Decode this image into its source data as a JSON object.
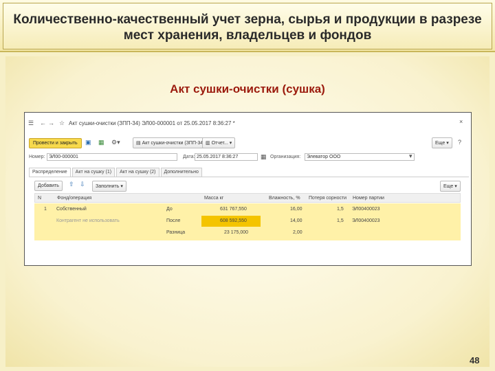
{
  "slide": {
    "title": "Количественно-качественный учет зерна, сырья и продукции в разрезе мест хранения, владельцев и фондов",
    "subtitle": "Акт сушки-очистки (сушка)",
    "page_number": "48"
  },
  "window": {
    "title": "Акт сушки-очистки (ЗПП-34) ЭЛ00-000001 от 25.05.2017 8:36:27 *",
    "toolbar": {
      "post_close": "Провести и закрыть",
      "act_label": "Акт сушки-очистки (ЗПП-34)",
      "report": "Отчет...",
      "more": "Еще"
    },
    "header": {
      "number_label": "Номер:",
      "number_value": "ЭЛ00-000001",
      "date_label": "Дата:",
      "date_value": "25.05.2017  8:36:27",
      "org_label": "Организация:",
      "org_value": "Элеватор ООО"
    },
    "tabs": [
      "Распределение",
      "Акт на сушку (1)",
      "Акт на сушку (2)",
      "Дополнительно"
    ],
    "table_toolbar": {
      "add": "Добавить",
      "fill": "Заполнить",
      "more": "Еще"
    },
    "table": {
      "columns": [
        "N",
        "Фонд/операция",
        "",
        "Масса кг",
        "Влажность, %",
        "Потеря сорности",
        "Номер партии"
      ],
      "rows": [
        {
          "n": "1",
          "fund": "Собственный",
          "stage": "До",
          "mass": "631 767,550",
          "humidity": "16,00",
          "loss": "1,5",
          "party": "ЭЛ00400023"
        },
        {
          "n": "",
          "fund": "Контрагент не использовать",
          "stage": "После",
          "mass": "608 592,550",
          "humidity": "14,00",
          "loss": "1,5",
          "party": "ЭЛ00400023"
        },
        {
          "n": "",
          "fund": "",
          "stage": "Разница",
          "mass": "23 175,000",
          "humidity": "2,00",
          "loss": "",
          "party": ""
        }
      ]
    }
  }
}
